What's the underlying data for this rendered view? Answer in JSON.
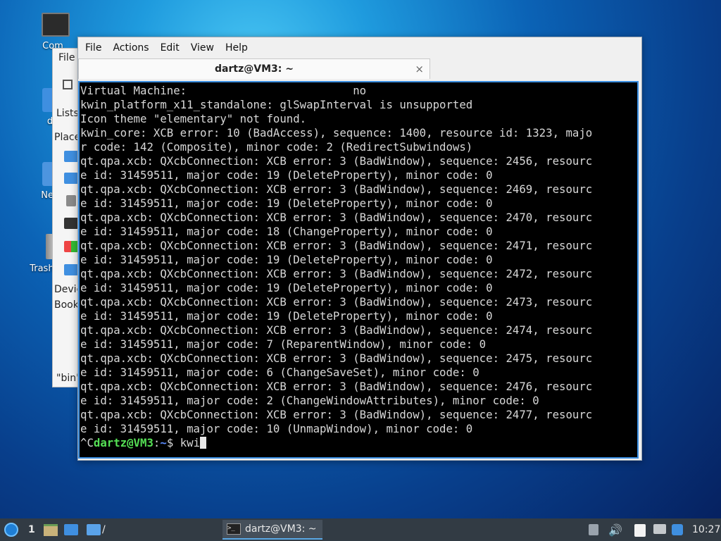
{
  "desktop": {
    "icons": [
      {
        "label": "Com",
        "icon": "computer-icon"
      },
      {
        "label": "da",
        "icon": "home-folder-icon"
      },
      {
        "label": "Netw",
        "icon": "network-icon"
      },
      {
        "label": "Trash (",
        "icon": "trash-icon"
      }
    ]
  },
  "filemanager": {
    "menu_file": "File",
    "lists_label": "Lists",
    "places_label": "Place",
    "devices_label": "Devic",
    "bookmarks_label": "Book",
    "status_label": "\"bin\""
  },
  "terminal": {
    "menus": [
      "File",
      "Actions",
      "Edit",
      "View",
      "Help"
    ],
    "tab_title": "dartz@VM3: ~",
    "close_glyph": "×",
    "lines": [
      "Virtual Machine:                         no",
      "kwin_platform_x11_standalone: glSwapInterval is unsupported",
      "Icon theme \"elementary\" not found.",
      "kwin_core: XCB error: 10 (BadAccess), sequence: 1400, resource id: 1323, majo",
      "r code: 142 (Composite), minor code: 2 (RedirectSubwindows)",
      "qt.qpa.xcb: QXcbConnection: XCB error: 3 (BadWindow), sequence: 2456, resourc",
      "e id: 31459511, major code: 19 (DeleteProperty), minor code: 0",
      "qt.qpa.xcb: QXcbConnection: XCB error: 3 (BadWindow), sequence: 2469, resourc",
      "e id: 31459511, major code: 19 (DeleteProperty), minor code: 0",
      "qt.qpa.xcb: QXcbConnection: XCB error: 3 (BadWindow), sequence: 2470, resourc",
      "e id: 31459511, major code: 18 (ChangeProperty), minor code: 0",
      "qt.qpa.xcb: QXcbConnection: XCB error: 3 (BadWindow), sequence: 2471, resourc",
      "e id: 31459511, major code: 19 (DeleteProperty), minor code: 0",
      "qt.qpa.xcb: QXcbConnection: XCB error: 3 (BadWindow), sequence: 2472, resourc",
      "e id: 31459511, major code: 19 (DeleteProperty), minor code: 0",
      "qt.qpa.xcb: QXcbConnection: XCB error: 3 (BadWindow), sequence: 2473, resourc",
      "e id: 31459511, major code: 19 (DeleteProperty), minor code: 0",
      "qt.qpa.xcb: QXcbConnection: XCB error: 3 (BadWindow), sequence: 2474, resourc",
      "e id: 31459511, major code: 7 (ReparentWindow), minor code: 0",
      "qt.qpa.xcb: QXcbConnection: XCB error: 3 (BadWindow), sequence: 2475, resourc",
      "e id: 31459511, major code: 6 (ChangeSaveSet), minor code: 0",
      "qt.qpa.xcb: QXcbConnection: XCB error: 3 (BadWindow), sequence: 2476, resourc",
      "e id: 31459511, major code: 2 (ChangeWindowAttributes), minor code: 0",
      "qt.qpa.xcb: QXcbConnection: XCB error: 3 (BadWindow), sequence: 2477, resourc",
      "e id: 31459511, major code: 10 (UnmapWindow), minor code: 0"
    ],
    "prompt": {
      "prefix": "^C",
      "user_host": "dartz@VM3",
      "sep": ":",
      "dir": "~",
      "symbol": "$ ",
      "command": "kwi"
    }
  },
  "taskbar": {
    "workspace": "1",
    "folder_path": "/",
    "task_label": "dartz@VM3: ~",
    "clock": "10:27"
  },
  "colors": {
    "terminal_border": "#3b8ee0",
    "prompt_user": "#55e055",
    "prompt_dir": "#5a8cff",
    "taskbar_bg": "#323b44"
  }
}
